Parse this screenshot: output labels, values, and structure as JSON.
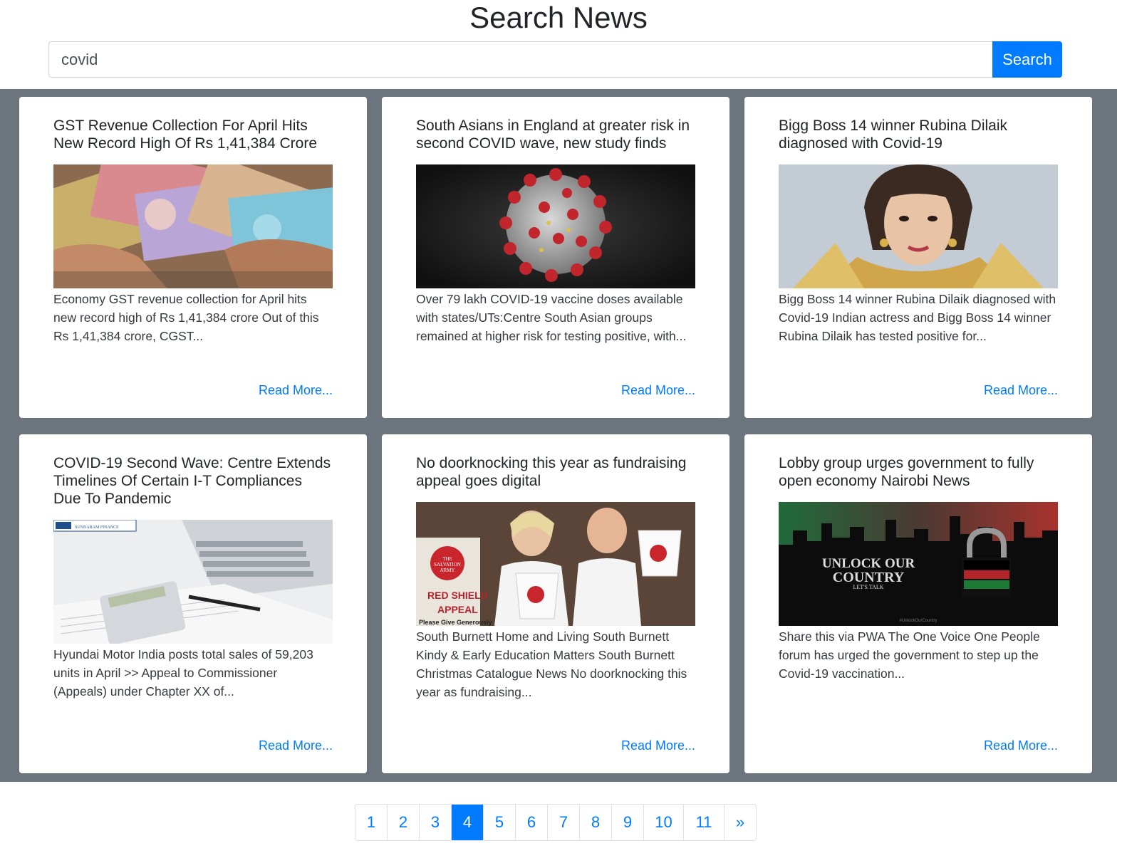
{
  "header": {
    "title": "Search News"
  },
  "search": {
    "value": "covid",
    "button_label": "Search"
  },
  "cards": [
    {
      "title": "GST Revenue Collection For April Hits New Record High Of Rs 1,41,384 Crore",
      "image": "currency-notes-image",
      "text": "Economy GST revenue collection for April hits new record high of Rs 1,41,384 crore Out of this Rs 1,41,384 crore, CGST...",
      "link": "Read More..."
    },
    {
      "title": "South Asians in England at greater risk in second COVID wave, new study finds",
      "image": "coronavirus-image",
      "text": "Over 79 lakh COVID-19 vaccine doses available with states/UTs:Centre South Asian groups remained at higher risk for testing positive, with...",
      "link": "Read More..."
    },
    {
      "title": "Bigg Boss 14 winner Rubina Dilaik diagnosed with Covid-19",
      "image": "portrait-image",
      "text": "Bigg Boss 14 winner Rubina Dilaik diagnosed with Covid-19 Indian actress and Bigg Boss 14 winner Rubina Dilaik has tested positive for...",
      "link": "Read More..."
    },
    {
      "title": "COVID-19 Second Wave: Centre Extends Timelines Of Certain I-T Compliances Due To Pandemic",
      "image": "calculator-laptop-image",
      "image_logo_text": "SUNDARAM FINANCE",
      "text": "Hyundai Motor India posts total sales of 59,203 units in April >> Appeal to Commissioner (Appeals) under Chapter XX of...",
      "link": "Read More..."
    },
    {
      "title": "No doorknocking this year as fundraising appeal goes digital",
      "image": "salvation-army-image",
      "image_sign_lines": [
        "THE",
        "SALVATION",
        "ARMY",
        "RED SHIELD",
        "APPEAL",
        "Please Give Generously"
      ],
      "text": "South Burnett Home and Living South Burnett Kindy & Early Education Matters South Burnett Christmas Catalogue News No doorknocking this year as fundraising...",
      "link": "Read More..."
    },
    {
      "title": "Lobby group urges government to fully open economy Nairobi News",
      "image": "unlock-country-image",
      "image_caption_lines": [
        "UNLOCK OUR",
        "COUNTRY",
        "LET'S TALK",
        "#UnlockOurCountry"
      ],
      "text": "Share this via PWA The One Voice One People forum has urged the government to step up the Covid-19 vaccination...",
      "link": "Read More..."
    }
  ],
  "pagination": {
    "pages": [
      "1",
      "2",
      "3",
      "4",
      "5",
      "6",
      "7",
      "8",
      "9",
      "10",
      "11"
    ],
    "active": "4",
    "next_label": "»"
  },
  "colors": {
    "primary": "#007bff",
    "results_bg": "#6c757d",
    "card_bg": "#ffffff"
  }
}
